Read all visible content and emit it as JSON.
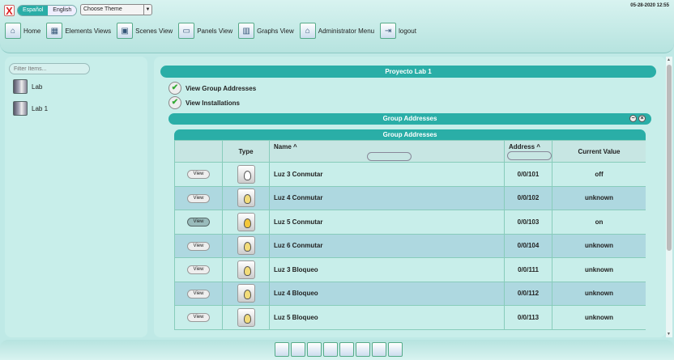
{
  "header": {
    "close_label": "X",
    "lang_active": "Español",
    "lang_other": "English",
    "theme_placeholder": "Choose Theme",
    "date": "05-28-2020 12:55"
  },
  "nav": [
    {
      "label": "Home",
      "icon": "home-icon"
    },
    {
      "label": "Elements Views",
      "icon": "elements-icon"
    },
    {
      "label": "Scenes View",
      "icon": "scenes-icon"
    },
    {
      "label": "Panels View",
      "icon": "panels-icon"
    },
    {
      "label": "Graphs View",
      "icon": "graphs-icon"
    },
    {
      "label": "Administrator Menu",
      "icon": "admin-icon"
    },
    {
      "label": "logout",
      "icon": "logout-icon"
    }
  ],
  "sidebar": {
    "filter_placeholder": "Filter Items...",
    "items": [
      {
        "label": "Lab"
      },
      {
        "label": "Lab 1"
      }
    ]
  },
  "main": {
    "project_title": "Proyecto Lab 1",
    "checks": [
      "View Group Addresses",
      "View Installations"
    ],
    "ga_bar_title": "Group Addresses",
    "table_title": "Group Addresses",
    "columns": {
      "type": "Type",
      "name": "Name",
      "address": "Address",
      "value": "Current Value"
    },
    "sort_glyph": "^",
    "view_label": "View",
    "rows": [
      {
        "name": "Luz 3 Conmutar",
        "address": "0/0/101",
        "value": "off"
      },
      {
        "name": "Luz 4 Conmutar",
        "address": "0/0/102",
        "value": "unknown"
      },
      {
        "name": "Luz 5 Conmutar",
        "address": "0/0/103",
        "value": "on"
      },
      {
        "name": "Luz 6 Conmutar",
        "address": "0/0/104",
        "value": "unknown"
      },
      {
        "name": "Luz 3 Bloqueo",
        "address": "0/0/111",
        "value": "unknown"
      },
      {
        "name": "Luz 4 Bloqueo",
        "address": "0/0/112",
        "value": "unknown"
      },
      {
        "name": "Luz 5 Bloqueo",
        "address": "0/0/113",
        "value": "unknown"
      }
    ]
  },
  "colors": {
    "accent": "#2aaea7",
    "bulb_off": "#ffffff",
    "bulb_unknown": "#f2dc7a",
    "bulb_on": "#f3c73a"
  }
}
